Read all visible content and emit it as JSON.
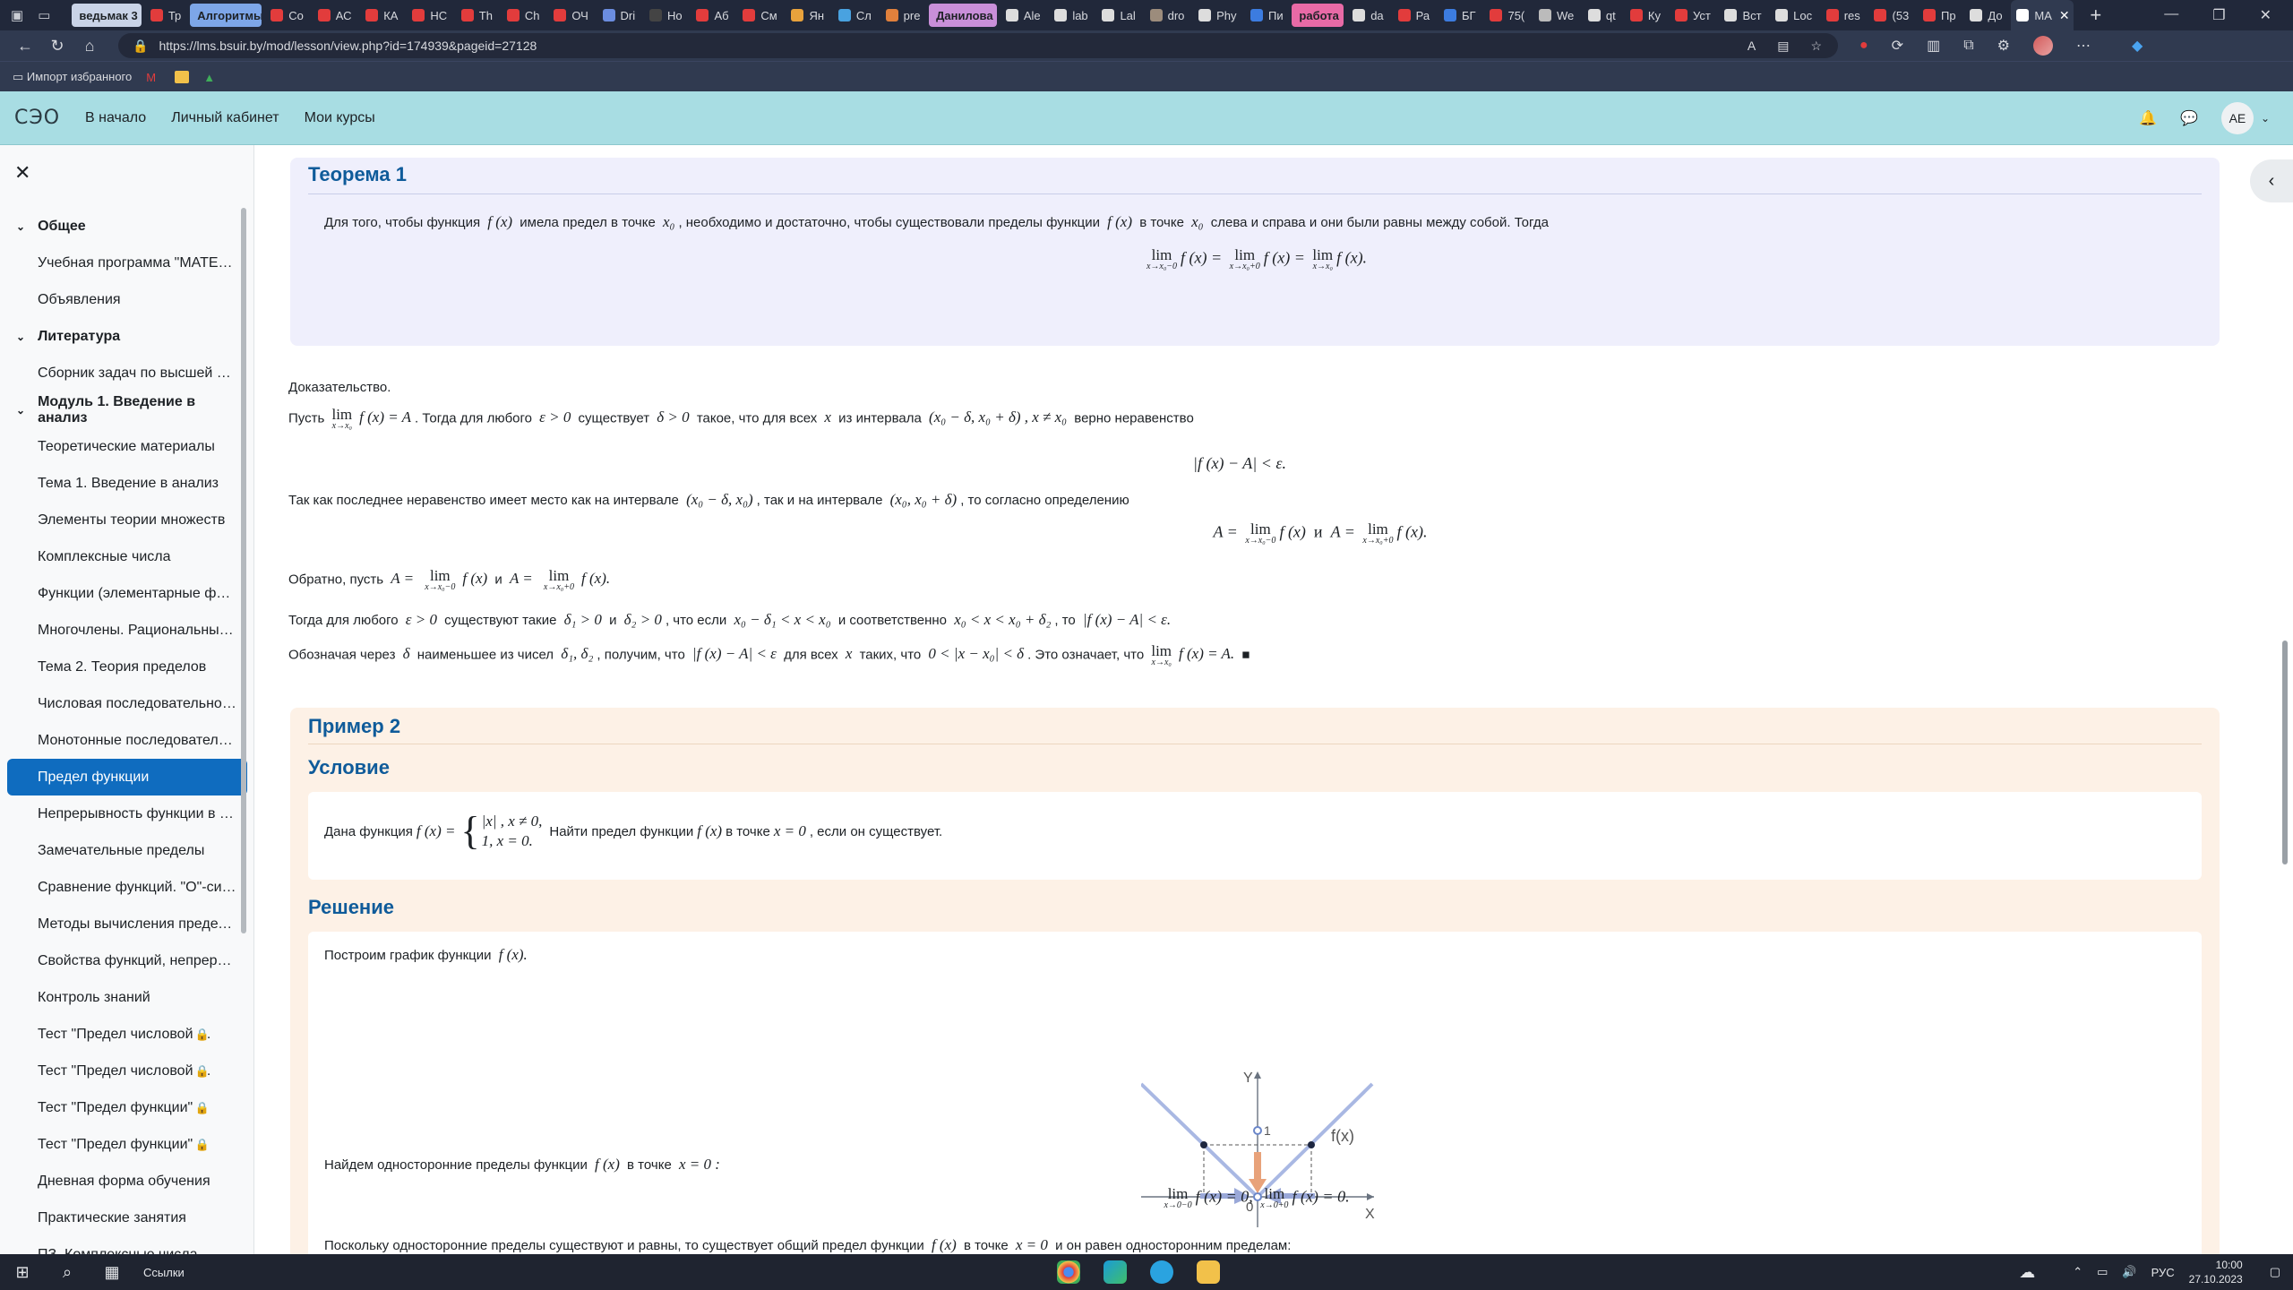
{
  "browser": {
    "tabs": [
      {
        "label": "ведьмак 3",
        "kind": "pill",
        "color": "#c9d3e7"
      },
      {
        "label": "Тр",
        "kind": "tab",
        "color": "#e23c3c"
      },
      {
        "label": "Алгоритмы",
        "kind": "pill",
        "color": "#7da6e8"
      },
      {
        "label": "Co",
        "kind": "tab",
        "color": "#e23c3c"
      },
      {
        "label": "АС",
        "kind": "tab",
        "color": "#e23c3c"
      },
      {
        "label": "КА",
        "kind": "tab",
        "color": "#e23c3c"
      },
      {
        "label": "НС",
        "kind": "tab",
        "color": "#e23c3c"
      },
      {
        "label": "Th",
        "kind": "tab",
        "color": "#e23c3c"
      },
      {
        "label": "Ch",
        "kind": "tab",
        "color": "#e23c3c"
      },
      {
        "label": "ОЧ",
        "kind": "tab",
        "color": "#e23c3c"
      },
      {
        "label": "Dri",
        "kind": "tab",
        "color": "#6b8de0"
      },
      {
        "label": "Но",
        "kind": "tab",
        "color": "#444"
      },
      {
        "label": "Аб",
        "kind": "tab",
        "color": "#e23c3c"
      },
      {
        "label": "См",
        "kind": "tab",
        "color": "#e23c3c"
      },
      {
        "label": "Ян",
        "kind": "tab",
        "color": "#e8a23c"
      },
      {
        "label": "Сл",
        "kind": "tab",
        "color": "#49a2e0"
      },
      {
        "label": "pre",
        "kind": "tab",
        "color": "#e0803c"
      },
      {
        "label": "Данилова",
        "kind": "pill",
        "color": "#c98fd9"
      },
      {
        "label": "Ale",
        "kind": "tab",
        "color": "#ddd"
      },
      {
        "label": "lab",
        "kind": "tab",
        "color": "#ddd"
      },
      {
        "label": "Lal",
        "kind": "tab",
        "color": "#ddd"
      },
      {
        "label": "dro",
        "kind": "tab",
        "color": "#9c8c7c"
      },
      {
        "label": "Phy",
        "kind": "tab",
        "color": "#ddd"
      },
      {
        "label": "Пи",
        "kind": "tab",
        "color": "#3c7ce0"
      },
      {
        "label": "работа",
        "kind": "pill",
        "color": "#e86aa6"
      },
      {
        "label": "da",
        "kind": "tab",
        "color": "#ddd"
      },
      {
        "label": "Ра",
        "kind": "tab",
        "color": "#e23c3c"
      },
      {
        "label": "БГ",
        "kind": "tab",
        "color": "#3c7ce0"
      },
      {
        "label": "75(",
        "kind": "tab",
        "color": "#e23c3c"
      },
      {
        "label": "We",
        "kind": "tab",
        "color": "#bbb"
      },
      {
        "label": "qt",
        "kind": "tab",
        "color": "#ddd"
      },
      {
        "label": "Ку",
        "kind": "tab",
        "color": "#e23c3c"
      },
      {
        "label": "Уст",
        "kind": "tab",
        "color": "#e23c3c"
      },
      {
        "label": "Вст",
        "kind": "tab",
        "color": "#ddd"
      },
      {
        "label": "Loc",
        "kind": "tab",
        "color": "#ddd"
      },
      {
        "label": "res",
        "kind": "tab",
        "color": "#e23c3c"
      },
      {
        "label": "(53",
        "kind": "tab",
        "color": "#e23c3c"
      },
      {
        "label": "Пр",
        "kind": "tab",
        "color": "#e23c3c"
      },
      {
        "label": "До",
        "kind": "tab",
        "color": "#ddd"
      },
      {
        "label": "МА",
        "kind": "active",
        "color": "#fff"
      }
    ],
    "url": "https://lms.bsuir.by/mod/lesson/view.php?id=174939&pageid=27128",
    "bookmarks_label": "Импорт избранного"
  },
  "site": {
    "logo": "СЭО",
    "nav": [
      "В начало",
      "Личный кабинет",
      "Мои курсы"
    ],
    "avatar_initials": "АЕ"
  },
  "course_index": [
    {
      "type": "section",
      "label": "Общее"
    },
    {
      "type": "item",
      "label": "Учебная программа \"МАТЕМАТИЧЕСКИЙ АНАЛИЗ\""
    },
    {
      "type": "item",
      "label": "Объявления"
    },
    {
      "type": "section",
      "label": "Литература"
    },
    {
      "type": "item",
      "label": "Сборник задач по высшей математике"
    },
    {
      "type": "section",
      "label": "Модуль 1. Введение в анализ"
    },
    {
      "type": "item",
      "label": "Теоретические материалы"
    },
    {
      "type": "item",
      "label": "Тема 1. Введение в анализ"
    },
    {
      "type": "item",
      "label": "Элементы теории множеств"
    },
    {
      "type": "item",
      "label": "Комплексные числа"
    },
    {
      "type": "item",
      "label": "Функции (элементарные функции)"
    },
    {
      "type": "item",
      "label": "Многочлены. Рациональные дроби"
    },
    {
      "type": "item",
      "label": "Тема 2. Теория пределов"
    },
    {
      "type": "item",
      "label": "Числовая последовательность"
    },
    {
      "type": "item",
      "label": "Монотонные последовательности"
    },
    {
      "type": "item",
      "label": "Предел функции",
      "active": true
    },
    {
      "type": "item",
      "label": "Непрерывность функции в точке"
    },
    {
      "type": "item",
      "label": "Замечательные пределы"
    },
    {
      "type": "item",
      "label": "Сравнение функций. \"О\"-символика"
    },
    {
      "type": "item",
      "label": "Методы вычисления пределов"
    },
    {
      "type": "item",
      "label": "Свойства функций, непрерывных на отрезке"
    },
    {
      "type": "item",
      "label": "Контроль знаний"
    },
    {
      "type": "item",
      "label": "Тест \"Предел числовой последовательности\"",
      "locked": true
    },
    {
      "type": "item",
      "label": "Тест \"Предел числовой последовательности\"",
      "locked": true
    },
    {
      "type": "item",
      "label": "Тест \"Предел функции\"",
      "locked": true
    },
    {
      "type": "item",
      "label": "Тест \"Предел функции\"",
      "locked": true
    },
    {
      "type": "item",
      "label": "Дневная форма обучения"
    },
    {
      "type": "item",
      "label": "Практические занятия"
    },
    {
      "type": "item",
      "label": "ПЗ. Комплексные числа"
    }
  ],
  "theorem": {
    "title": "Теорема 1",
    "text_a": "Для того, чтобы функция",
    "f": "f (x)",
    "text_b": "имела предел в точке",
    "x0": "x₀",
    "text_c": ", необходимо и достаточно, чтобы существовали пределы функции",
    "text_d": "в точке",
    "text_e": "слева и справа и они были равны между собой. Тогда",
    "formula_parts": [
      "f (x) =",
      "f (x) =",
      "f (x)."
    ],
    "formula_subs": [
      "x→x₀−0",
      "x→x₀+0",
      "x→x₀"
    ]
  },
  "proof": {
    "heading": "Доказательство.",
    "l1_a": "Пусть",
    "l1_lim_sub": "x→x₀",
    "l1_eq": "f (x) = A",
    "l1_b": ". Тогда для любого",
    "l1_eps": "ε > 0",
    "l1_c": "существует",
    "l1_delta": "δ > 0",
    "l1_d": "такое, что для всех",
    "l1_x": "x",
    "l1_e": "из интервала",
    "l1_int": "(x₀ − δ, x₀ + δ) ,  x ≠ x₀",
    "l1_f": "верно неравенство",
    "ineq": "|f (x) − A| < ε.",
    "l2_a": "Так как последнее неравенство имеет место как на интервале",
    "l2_int1": "(x₀ − δ, x₀)",
    "l2_b": ", так и на интервале",
    "l2_int2": "(x₀, x₀ + δ)",
    "l2_c": ", то согласно определению",
    "eq2_a": "A =",
    "eq2_f1": "f (x)",
    "eq2_and": "и",
    "eq2_b": "A =",
    "eq2_f2": "f (x).",
    "eq2_sub1": "x→x₀−0",
    "eq2_sub2": "x→x₀+0",
    "l3_a": "Обратно, пусть",
    "l3_A1": "A =",
    "l3_f1": "f (x)",
    "l3_and": "и",
    "l3_A2": "A =",
    "l3_f2": "f (x).",
    "l4_a": "Тогда для любого",
    "l4_eps": "ε > 0",
    "l4_b": "существуют такие",
    "l4_d1": "δ₁ > 0",
    "l4_c": "и",
    "l4_d2": "δ₂ > 0",
    "l4_d": ", что если",
    "l4_in": "x₀ − δ₁ < x < x₀",
    "l4_e": "и соответственно",
    "l4_in2": "x₀ < x < x₀ + δ₂",
    "l4_f": ", то",
    "l4_res": "|f (x) − A| < ε.",
    "l5_a": "Обозначая через",
    "l5_delta": "δ",
    "l5_b": "наименьшее из чисел",
    "l5_nums": "δ₁, δ₂",
    "l5_c": ", получим, что",
    "l5_ineq": "|f (x) − A| < ε",
    "l5_d": "для всех",
    "l5_x": "x",
    "l5_e": "таких, что",
    "l5_cond": "0 < |x − x₀| < δ",
    "l5_f": ". Это означает, что",
    "l5_res": "f (x) = A.",
    "l5_qed": "■"
  },
  "example": {
    "title": "Пример 2",
    "cond_title": "Условие",
    "cond_a": "Дана функция",
    "cond_f": "f (x) =",
    "case1": "|x| ,   x ≠ 0,",
    "case2": "1,  x = 0.",
    "cond_b": "Найти предел функции",
    "cond_c": "в точке",
    "cond_x0": "x = 0",
    "cond_d": ", если он существует.",
    "sol_title": "Решение",
    "sol_a": "Построим график функции",
    "sol_f": "f (x).",
    "graph_labels": {
      "y": "Y",
      "x": "X",
      "one": "1",
      "zero": "0",
      "fx": "f(x)"
    },
    "sol_b": "Найдем односторонние пределы функции",
    "sol_c": "в точке",
    "sol_x0": "x = 0 :",
    "sol_eq1": "f (x) = 0,",
    "sol_eq2": "f (x) = 0.",
    "sol_sub1": "x→0−0",
    "sol_sub2": "x→0+0",
    "sol_last_a": "Поскольку односторонние пределы существуют и равны, то существует общий предел функции",
    "sol_last_b": "в точке",
    "sol_last_x": "x = 0",
    "sol_last_c": "и он равен односторонним пределам:"
  },
  "taskbar": {
    "label": "Ссылки",
    "lang": "РУС",
    "time": "10:00",
    "date": "27.10.2023"
  }
}
